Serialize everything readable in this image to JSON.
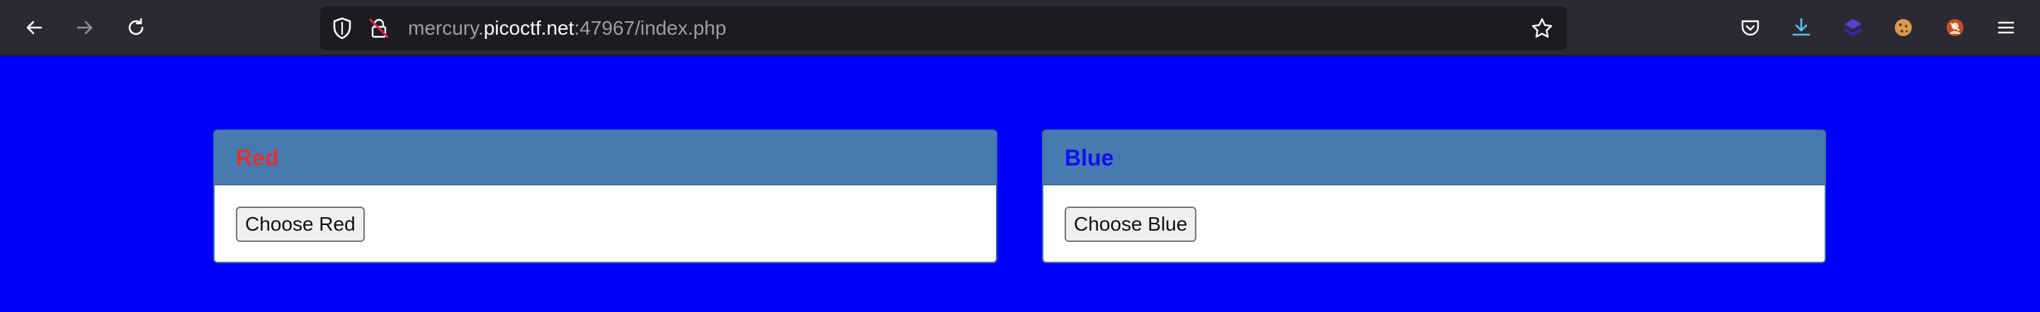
{
  "browser": {
    "url_prefix": "mercury.",
    "url_host": "picoctf.net",
    "url_suffix": ":47967/index.php",
    "icons": [
      "back-arrow-icon",
      "forward-arrow-icon",
      "reload-icon",
      "shield-icon",
      "insecure-lock-icon",
      "star-icon",
      "pocket-icon",
      "download-icon",
      "extension-icon",
      "cookie-icon",
      "profile-icon",
      "menu-icon"
    ]
  },
  "page": {
    "background_color": "#0000ff",
    "cards": [
      {
        "title": "Red",
        "title_color": "#dd3333",
        "button_label": "Choose Red"
      },
      {
        "title": "Blue",
        "title_color": "#1010ee",
        "button_label": "Choose Blue"
      }
    ]
  }
}
